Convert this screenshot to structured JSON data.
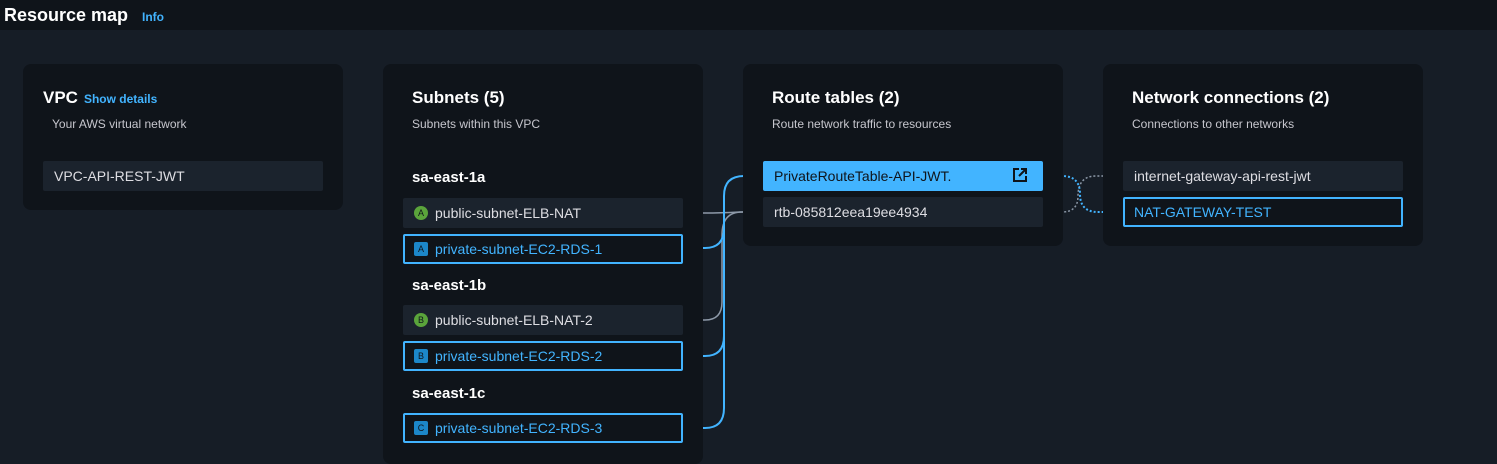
{
  "header": {
    "title": "Resource map",
    "info_label": "Info"
  },
  "vpc": {
    "title": "VPC",
    "show_details": "Show details",
    "subtitle": "Your AWS virtual network",
    "name": "VPC-API-REST-JWT"
  },
  "subnets": {
    "title": "Subnets (5)",
    "subtitle": "Subnets within this VPC",
    "zones": [
      {
        "name": "sa-east-1a",
        "items": [
          {
            "label": "public-subnet-ELB-NAT",
            "badge": "A"
          },
          {
            "label": "private-subnet-EC2-RDS-1",
            "badge": "A"
          }
        ]
      },
      {
        "name": "sa-east-1b",
        "items": [
          {
            "label": "public-subnet-ELB-NAT-2",
            "badge": "B"
          },
          {
            "label": "private-subnet-EC2-RDS-2",
            "badge": "B"
          }
        ]
      },
      {
        "name": "sa-east-1c",
        "items": [
          {
            "label": "private-subnet-EC2-RDS-3",
            "badge": "C"
          }
        ]
      }
    ]
  },
  "route_tables": {
    "title": "Route tables (2)",
    "subtitle": "Route network traffic to resources",
    "items": [
      {
        "label": "PrivateRouteTable-API-JWT.",
        "icon": "external-link-icon"
      },
      {
        "label": "rtb-085812eea19ee4934"
      }
    ]
  },
  "network_connections": {
    "title": "Network connections (2)",
    "subtitle": "Connections to other networks",
    "items": [
      {
        "label": "internet-gateway-api-rest-jwt"
      },
      {
        "label": "NAT-GATEWAY-TEST"
      }
    ]
  },
  "colors": {
    "accent": "#42b4ff",
    "public_badge": "#5aa43b",
    "private_badge": "#1c87c9",
    "link_muted": "#8d99a8"
  }
}
